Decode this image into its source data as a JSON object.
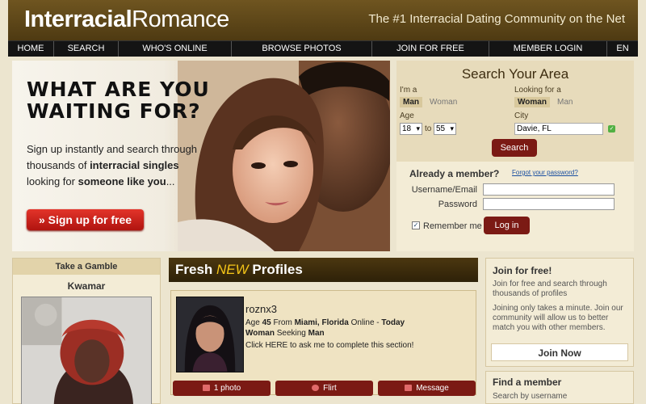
{
  "header": {
    "logo_bold": "Interracial",
    "logo_rest": "Romance",
    "tagline": "The #1 Interracial Dating Community on the Net"
  },
  "nav": [
    {
      "label": "HOME"
    },
    {
      "label": "SEARCH"
    },
    {
      "label": "WHO'S ONLINE"
    },
    {
      "label": "BROWSE PHOTOS"
    },
    {
      "label": "JOIN FOR FREE"
    },
    {
      "label": "MEMBER LOGIN"
    },
    {
      "label": "EN"
    }
  ],
  "hero": {
    "headline": "WHAT ARE YOU\nWAITING FOR?",
    "sub_part1": "Sign up instantly and search through thousands of ",
    "sub_bold1": "interracial singles",
    "sub_part2": " looking for ",
    "sub_bold2": "someone like you",
    "sub_part3": "...",
    "signup_label": "» Sign up for free"
  },
  "search": {
    "title": "Search Your Area",
    "im_a_label": "I'm a",
    "im_a_selected": "Man",
    "im_a_other": "Woman",
    "looking_label": "Looking for a",
    "looking_selected": "Woman",
    "looking_other": "Man",
    "age_label": "Age",
    "age_min": "18",
    "age_to": "to",
    "age_max": "55",
    "city_label": "City",
    "city_value": "Davie, FL",
    "button_label": "Search"
  },
  "member": {
    "title": "Already a member?",
    "forgot": "Forgot your password?",
    "username_label": "Username/Email",
    "password_label": "Password",
    "remember_label": "Remember me",
    "remember_checked": true,
    "login_label": "Log in"
  },
  "gamble": {
    "header": "Take a Gamble",
    "name": "Kwamar"
  },
  "fresh": {
    "title_a": "Fresh ",
    "title_new": "NEW",
    "title_b": " Profiles",
    "profile": {
      "username": "roznx3",
      "age_prefix": "Age ",
      "age": "45",
      "from_prefix": " From ",
      "location": "Miami, Florida",
      "online_prefix": " Online - ",
      "online": "Today",
      "gender": "Woman",
      "seeking_word": " Seeking ",
      "seeking": "Man",
      "blurb": "Click HERE to ask me to complete this section!"
    },
    "actions": {
      "photo": "1 photo",
      "flirt": "Flirt",
      "message": "Message"
    }
  },
  "join": {
    "title": "Join for free!",
    "text1": "Join for free and search through thousands of profiles",
    "text2": "Joining only takes a minute. Join our community will allow us to better match you with other members.",
    "button": "Join Now"
  },
  "find": {
    "title": "Find a member",
    "sub": "Search by username"
  },
  "colors": {
    "header_brown": "#5c4516",
    "button_red": "#7b1a14",
    "signup_red": "#d0241c",
    "new_yellow": "#f4c518",
    "panel_bg": "#f3ecd6"
  }
}
